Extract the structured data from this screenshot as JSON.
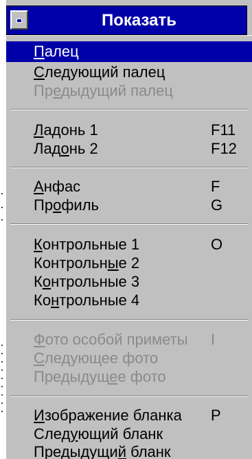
{
  "title": "Показать",
  "menu": {
    "group1": [
      {
        "pre": "",
        "u": "П",
        "post": "алец",
        "shortcut": ""
      },
      {
        "pre": "",
        "u": "С",
        "post": "ледующий палец",
        "shortcut": ""
      },
      {
        "pre": "Пр",
        "u": "е",
        "post": "дыдущий палец",
        "shortcut": ""
      }
    ],
    "group2": [
      {
        "pre": "",
        "u": "Л",
        "post": "адонь 1",
        "shortcut": "F11"
      },
      {
        "pre": "Лад",
        "u": "о",
        "post": "нь 2",
        "shortcut": "F12"
      }
    ],
    "group3": [
      {
        "pre": "",
        "u": "А",
        "post": "нфас",
        "shortcut": "F"
      },
      {
        "pre": "Пр",
        "u": "о",
        "post": "филь",
        "shortcut": "G"
      }
    ],
    "group4": [
      {
        "pre": "",
        "u": "К",
        "post": "онтрольные 1",
        "shortcut": "O"
      },
      {
        "pre": "Контрольн",
        "u": "ы",
        "post": "е 2",
        "shortcut": ""
      },
      {
        "pre": "К",
        "u": "о",
        "post": "нтрольные 3",
        "shortcut": ""
      },
      {
        "pre": "Ко",
        "u": "н",
        "post": "трольные 4",
        "shortcut": ""
      }
    ],
    "group5": [
      {
        "pre": "",
        "u": "Ф",
        "post": "ото особой приметы",
        "shortcut": "I"
      },
      {
        "pre": "",
        "u": "С",
        "post": "ледующее фото",
        "shortcut": ""
      },
      {
        "pre": "Предыдущ",
        "u": "е",
        "post": "е фото",
        "shortcut": ""
      }
    ],
    "group6": [
      {
        "pre": "",
        "u": "И",
        "post": "зображение бланка",
        "shortcut": "P"
      },
      {
        "pre": "След",
        "u": "у",
        "post": "ющий бланк",
        "shortcut": ""
      },
      {
        "pre": "Предыдущи",
        "u": "й",
        "post": " бланк",
        "shortcut": ""
      }
    ]
  }
}
